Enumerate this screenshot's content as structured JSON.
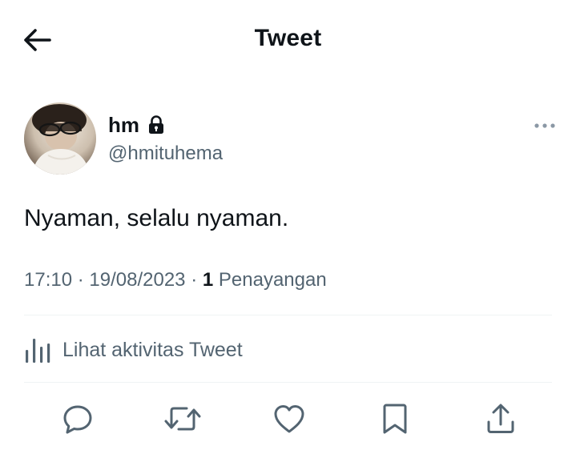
{
  "header": {
    "back_icon": "arrow-left-icon",
    "title": "Tweet"
  },
  "author": {
    "display_name": "hm",
    "protected_icon": "lock-icon",
    "handle": "@hmituhema",
    "more_icon": "more-horizontal-icon"
  },
  "tweet": {
    "text": "Nyaman, selalu nyaman.",
    "time": "17:10",
    "separator": "·",
    "date": "19/08/2023",
    "views_count": "1",
    "views_label": "Penayangan"
  },
  "activity": {
    "icon": "analytics-bars-icon",
    "label": "Lihat aktivitas Tweet"
  },
  "actions": {
    "reply_icon": "reply-icon",
    "retweet_icon": "retweet-icon",
    "like_icon": "heart-icon",
    "bookmark_icon": "bookmark-icon",
    "share_icon": "share-icon"
  },
  "colors": {
    "text_primary": "#0f1419",
    "text_secondary": "#536471",
    "divider": "#eff3f4",
    "action_icon": "#536471"
  }
}
